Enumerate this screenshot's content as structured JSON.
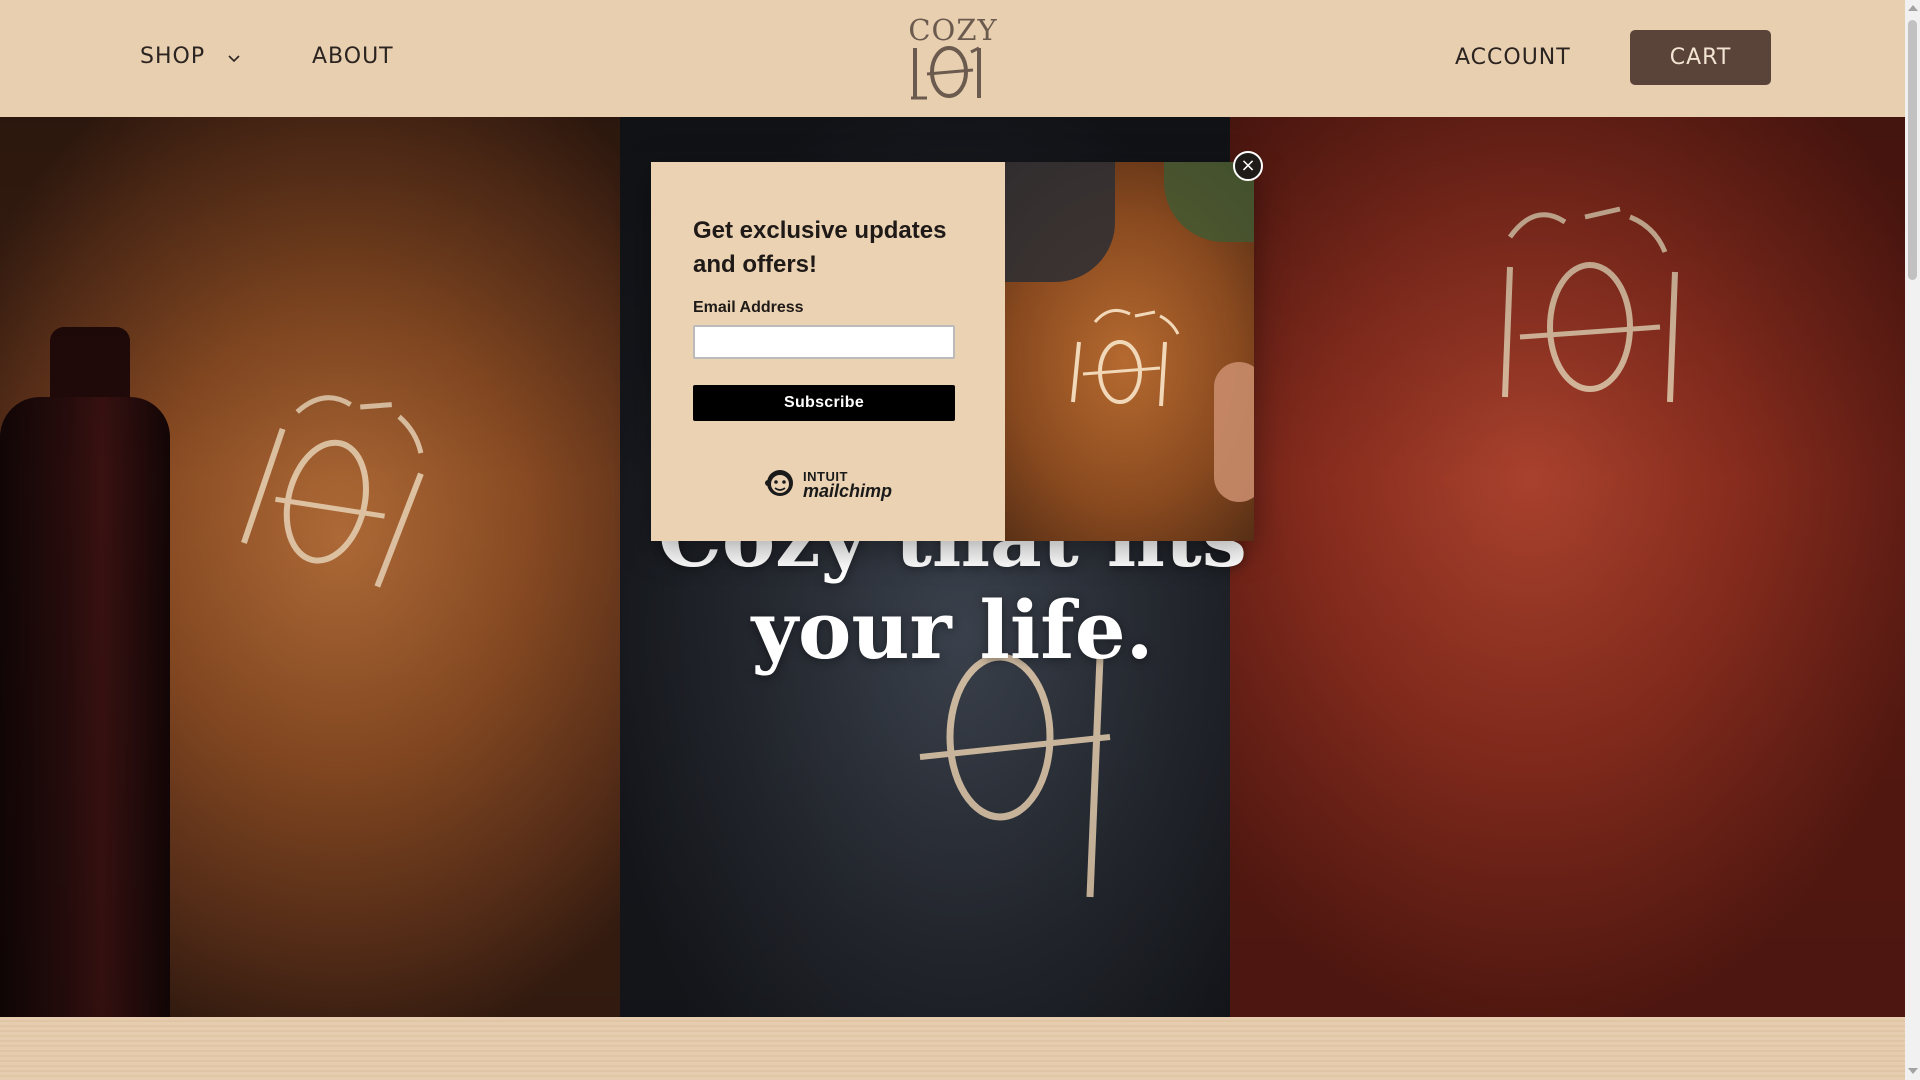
{
  "header": {
    "nav": {
      "shop_label": "SHOP",
      "about_label": "ABOUT",
      "account_label": "ACCOUNT",
      "cart_label": "CART"
    },
    "logo": {
      "top": "COZY",
      "bottom": "101"
    }
  },
  "hero": {
    "title_line1": "Cozy that fits",
    "title_line2": "your life."
  },
  "popup": {
    "title": "Get exclusive updates and offers!",
    "email_label": "Email Address",
    "email_value": "",
    "subscribe_label": "Subscribe",
    "badge_top": "INTUIT",
    "badge_bottom": "mailchimp",
    "close_glyph": "×"
  },
  "colors": {
    "header_bg": "#e8cfb0",
    "cart_bg": "#5a4439",
    "subscribe_bg": "#000000"
  },
  "icons": [
    "chevron-down-icon",
    "close-icon",
    "mailchimp-logo-icon",
    "cozy101-logo"
  ]
}
